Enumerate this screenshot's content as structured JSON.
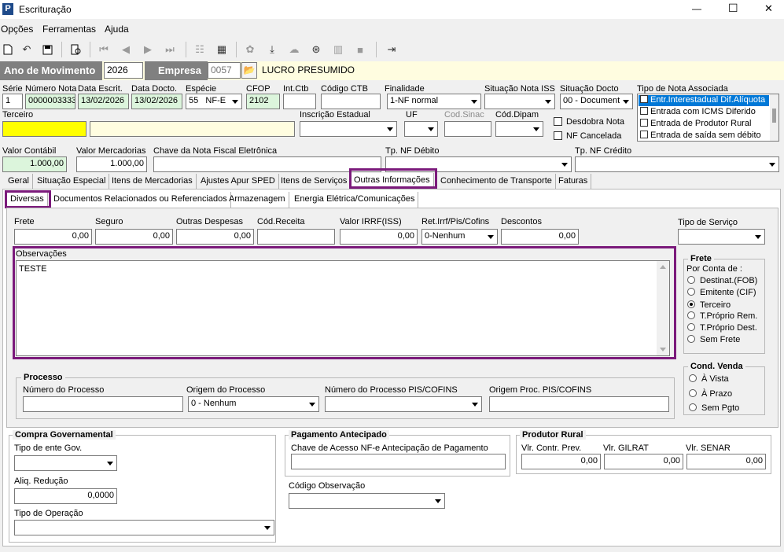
{
  "window": {
    "title": "Escrituração",
    "minimize": "—",
    "maximize": "☐",
    "close": "✕"
  },
  "menu": [
    "Opções",
    "Ferramentas",
    "Ajuda"
  ],
  "toolbar_icons": [
    "new-icon",
    "undo-icon",
    "save-icon",
    "preview-icon",
    "first-icon",
    "prev-icon",
    "next-icon",
    "last-icon",
    "tree-icon",
    "calc-icon",
    "puzzle-icon",
    "download-icon",
    "cloud-icon",
    "cb-icon",
    "split-icon",
    "square-icon",
    "exit-icon"
  ],
  "header": {
    "ano_label": "Ano de Movimento",
    "ano_value": "2026",
    "empresa_label": "Empresa",
    "empresa_code": "0057",
    "empresa_name": "LUCRO PRESUMIDO"
  },
  "row1": {
    "serie_label": "Série",
    "serie": "1",
    "numero_label": "Número Nota",
    "numero": "0000003333",
    "data_escrit_label": "Data Escrit.",
    "data_escrit": "13/02/2026",
    "data_docto_label": "Data Docto.",
    "data_docto": "13/02/2026",
    "especie_label": "Espécie",
    "especie_num": "55",
    "especie": "NF-E",
    "cfop_label": "CFOP",
    "cfop": "2102",
    "intctb_label": "Int.Ctb",
    "codctb_label": "Código CTB",
    "finalidade_label": "Finalidade",
    "finalidade": "1-NF normal",
    "sit_iss_label": "Situação Nota ISS",
    "sit_docto_label": "Situação Docto",
    "sit_docto": "00 - Document",
    "tipo_assoc_label": "Tipo de Nota Associada"
  },
  "tipo_assoc_items": [
    "Entr.Interestadual Dif.Alíquota",
    "Entrada com ICMS Diferido",
    "Entrada de Produtor Rural",
    "Entrada de saída sem débito"
  ],
  "row2": {
    "terceiro_label": "Terceiro",
    "insc_label": "Inscrição Estadual",
    "uf_label": "UF",
    "cod_sinac_label": "Cod.Sinac",
    "cod_dipam_label": "Cód.Dipam",
    "desdobra": "Desdobra Nota",
    "cancelada": "NF Cancelada"
  },
  "row3": {
    "valor_contabil_label": "Valor Contábil",
    "valor_contabil": "1.000,00",
    "valor_merc_label": "Valor Mercadorias",
    "valor_merc": "1.000,00",
    "chave_label": "Chave da Nota Fiscal Eletrônica",
    "tp_debito_label": "Tp. NF Débito",
    "tp_credito_label": "Tp. NF Crédito"
  },
  "tabs": [
    "Geral",
    "Situação Especial",
    "Itens de Mercadorias",
    "Ajustes Apur SPED",
    "Itens de Serviços",
    "Outras Informações",
    "Conhecimento de Transporte",
    "Faturas"
  ],
  "subtabs": [
    "Diversas",
    "Documentos Relacionados ou Referenciados",
    "Armazenagem",
    "Energia Elétrica/Comunicações"
  ],
  "diversas": {
    "frete_label": "Frete",
    "frete": "0,00",
    "seguro_label": "Seguro",
    "seguro": "0,00",
    "outras_label": "Outras Despesas",
    "outras": "0,00",
    "cod_receita_label": "Cód.Receita",
    "irrf_label": "Valor IRRF(ISS)",
    "irrf": "0,00",
    "ret_label": "Ret.Irrf/Pis/Cofins",
    "ret": "0-Nenhum",
    "descontos_label": "Descontos",
    "descontos": "0,00",
    "tipo_servico_label": "Tipo de Serviço",
    "obs_label": "Observações",
    "obs": "TESTE"
  },
  "frete_group": {
    "title": "Frete",
    "por_conta": "Por Conta de :",
    "options": [
      "Destinat.(FOB)",
      "Emitente (CIF)",
      "Terceiro",
      "T.Próprio Rem.",
      "T.Próprio Dest.",
      "Sem Frete"
    ],
    "selected": 2
  },
  "cond_venda": {
    "title": "Cond. Venda",
    "options": [
      "À Vista",
      "À Prazo",
      "Sem Pgto"
    ]
  },
  "processo": {
    "title": "Processo",
    "numero_label": "Número do Processo",
    "origem_label": "Origem do Processo",
    "origem": "0 - Nenhum",
    "numero_pis_label": "Número do Processo PIS/COFINS",
    "origem_pis_label": "Origem Proc. PIS/COFINS"
  },
  "compra_gov": {
    "title": "Compra Governamental",
    "tipo_ente_label": "Tipo de ente Gov.",
    "aliq_label": "Aliq. Redução",
    "aliq": "0,0000",
    "tipo_op_label": "Tipo de Operação"
  },
  "pagamento": {
    "title": "Pagamento Antecipado",
    "chave_label": "Chave de Acesso NF-e Antecipação de Pagamento",
    "cod_obs_label": "Código Observação"
  },
  "produtor": {
    "title": "Produtor Rural",
    "contr_label": "Vlr. Contr. Prev.",
    "contr": "0,00",
    "gilrat_label": "Vlr. GILRAT",
    "gilrat": "0,00",
    "senar_label": "Vlr. SENAR",
    "senar": "0,00"
  }
}
